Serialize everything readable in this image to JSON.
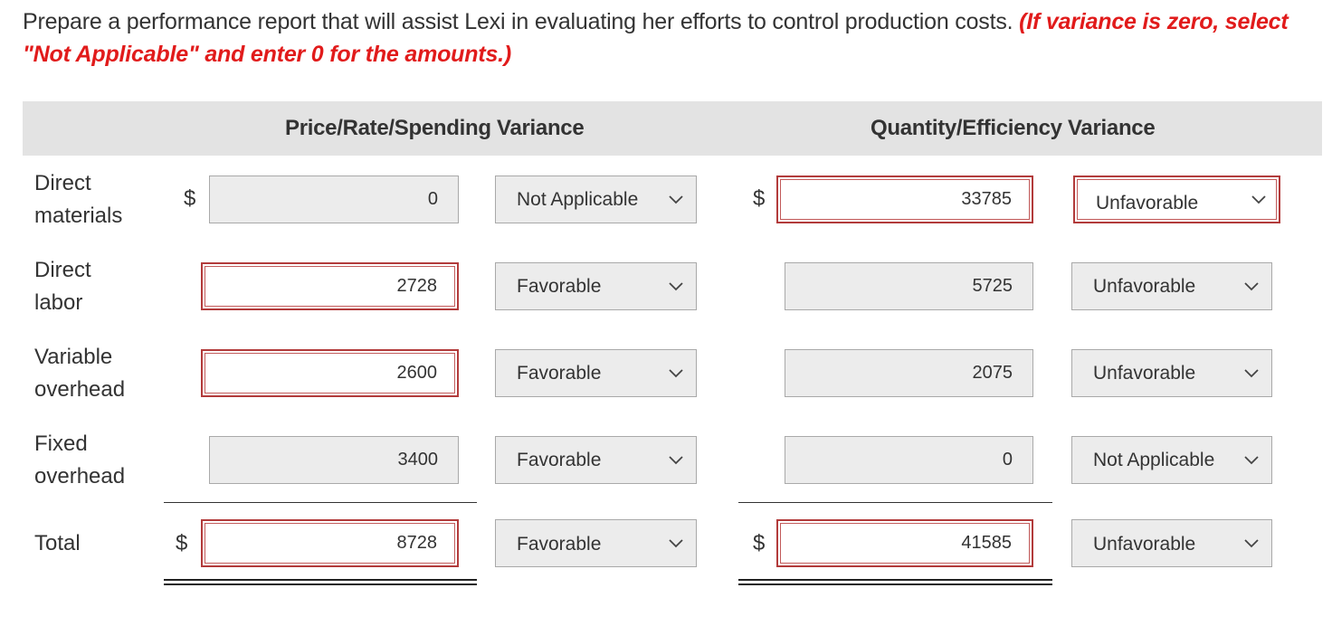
{
  "instructions": {
    "text": "Prepare a performance report that will assist Lexi in evaluating her efforts to control production costs.",
    "note": "(If variance is zero, select \"Not Applicable\" and enter 0 for the amounts.)"
  },
  "columns": {
    "price": "Price/Rate/Spending Variance",
    "quantity": "Quantity/Efficiency Variance"
  },
  "currency": "$",
  "rows": [
    {
      "label": "Direct materials",
      "price_value": "0",
      "price_effect": "Not Applicable",
      "qty_value": "33785",
      "qty_effect": "Unfavorable"
    },
    {
      "label": "Direct labor",
      "price_value": "2728",
      "price_effect": "Favorable",
      "qty_value": "5725",
      "qty_effect": "Unfavorable"
    },
    {
      "label": "Variable overhead",
      "price_value": "2600",
      "price_effect": "Favorable",
      "qty_value": "2075",
      "qty_effect": "Unfavorable"
    },
    {
      "label": "Fixed overhead",
      "price_value": "3400",
      "price_effect": "Favorable",
      "qty_value": "0",
      "qty_effect": "Not Applicable"
    },
    {
      "label": "Total",
      "price_value": "8728",
      "price_effect": "Favorable",
      "qty_value": "41585",
      "qty_effect": "Unfavorable"
    }
  ],
  "colors": {
    "error_border": "#b23b3b",
    "note_red": "#e11b1b",
    "header_bg": "#e3e3e3",
    "input_bg": "#ececec"
  }
}
